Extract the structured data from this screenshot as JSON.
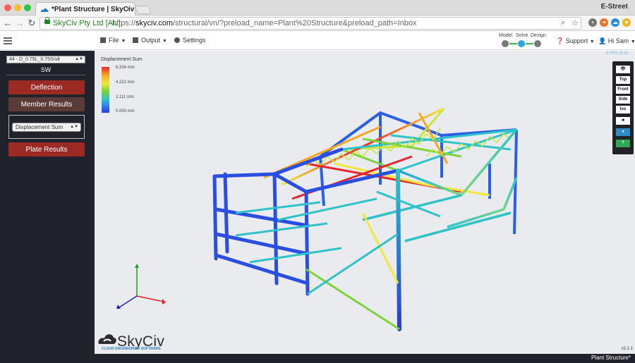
{
  "browser": {
    "tab_title": "*Plant Structure | SkyCiv",
    "tab_close": "×",
    "profile_name": "E-Street",
    "site_identity": "SkyCiv Pty Ltd [AU]",
    "url_prefix": "https://",
    "url_domain": "skyciv.com",
    "url_path": "/structural/vn/?preload_name=Plant%20Structure&preload_path=Inbox"
  },
  "header": {
    "menu": [
      {
        "label": "File",
        "icon": "file-icon"
      },
      {
        "label": "Output",
        "icon": "monitor-icon"
      },
      {
        "label": "Settings",
        "icon": "gear-icon"
      }
    ],
    "workflow": [
      "Model",
      "Solve",
      "Design"
    ],
    "active_step": "Solve",
    "support_label": "Support",
    "user_label": "Hi Sam"
  },
  "left_panel": {
    "load_combination": "#4 - D_0.75L_0.75S/ult",
    "load_case_name": "SW",
    "buttons": {
      "deflection": "Deflection",
      "member_results": "Member Results",
      "plate_results": "Plate Results"
    },
    "result_type": "Displacement Sum"
  },
  "viewport": {
    "legend": {
      "title": "Displacement Sum",
      "values": [
        "6.334 mm",
        "4.222 mm",
        "2.111 mm",
        "0.000 mm"
      ]
    },
    "fps": "0 FPS (0-0)",
    "view_buttons": [
      "Top",
      "Front",
      "Side",
      "Iso"
    ],
    "logo_text": "SkyCiv",
    "logo_tagline": "CLOUD ENGINEERING SOFTWARE",
    "version": "v2.1.1"
  },
  "status": {
    "project_name": "Plant Structure*"
  },
  "colors": {
    "panel_bg": "#20232b",
    "button_red": "#9c2a24",
    "button_dark": "#5c3a38",
    "viewport_bg": "#e9ebee",
    "accent_blue": "#2aa6d8",
    "site_green": "#1a8a1a"
  }
}
